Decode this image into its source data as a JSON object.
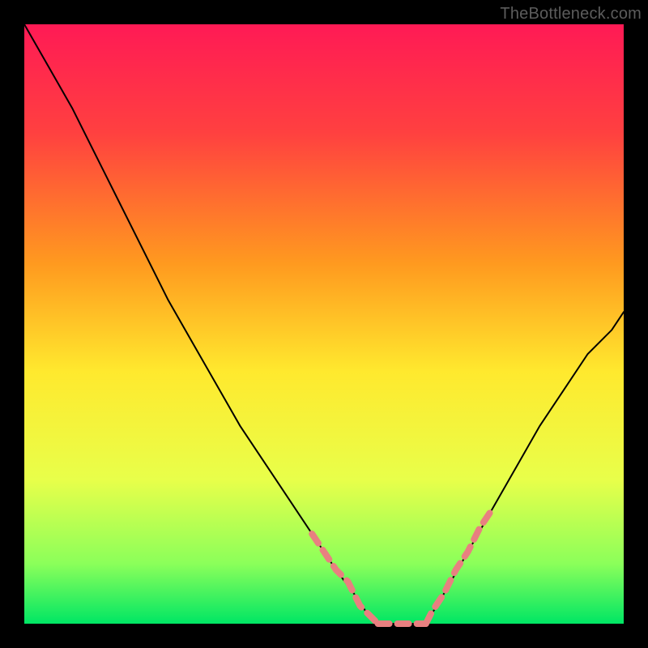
{
  "watermark": "TheBottleneck.com",
  "chart_data": {
    "type": "line",
    "title": "",
    "xlabel": "",
    "ylabel": "",
    "xlim": [
      0,
      100
    ],
    "ylim": [
      0,
      100
    ],
    "gradient": {
      "stops": [
        {
          "pct": 0,
          "color": "#ff1a55"
        },
        {
          "pct": 18,
          "color": "#ff4040"
        },
        {
          "pct": 40,
          "color": "#ff9a1f"
        },
        {
          "pct": 58,
          "color": "#ffe92e"
        },
        {
          "pct": 76,
          "color": "#e8ff4a"
        },
        {
          "pct": 90,
          "color": "#8bff5a"
        },
        {
          "pct": 100,
          "color": "#00e664"
        }
      ]
    },
    "series": [
      {
        "name": "left-curve",
        "stroke": "#000000",
        "width": 2,
        "x": [
          0,
          4,
          8,
          12,
          16,
          20,
          24,
          28,
          32,
          36,
          40,
          44,
          48,
          52,
          55,
          57,
          59
        ],
        "y": [
          100,
          93,
          86,
          78,
          70,
          62,
          54,
          47,
          40,
          33,
          27,
          21,
          15,
          9,
          5,
          2,
          0
        ]
      },
      {
        "name": "right-curve",
        "stroke": "#000000",
        "width": 2,
        "x": [
          67,
          70,
          74,
          78,
          82,
          86,
          90,
          94,
          98,
          100
        ],
        "y": [
          0,
          5,
          12,
          19,
          26,
          33,
          39,
          45,
          49,
          52
        ]
      },
      {
        "name": "plateau",
        "stroke": "#000000",
        "width": 2,
        "x": [
          59,
          61,
          63,
          65,
          67
        ],
        "y": [
          0,
          0,
          0,
          0,
          0
        ]
      }
    ],
    "dotted_segments": {
      "color": "#e88080",
      "width": 8,
      "segments": [
        {
          "name": "left-descent",
          "x": [
            48,
            50,
            52,
            54,
            55,
            56,
            57,
            58,
            59
          ],
          "y": [
            15,
            12,
            9,
            7,
            5,
            3,
            2,
            1,
            0
          ]
        },
        {
          "name": "bottom",
          "x": [
            59,
            60,
            61,
            62,
            63,
            64,
            65,
            66,
            67
          ],
          "y": [
            0,
            0,
            0,
            0,
            0,
            0,
            0,
            0,
            0
          ]
        },
        {
          "name": "right-ascent",
          "x": [
            67,
            68,
            70,
            72,
            74,
            76,
            78
          ],
          "y": [
            0,
            2,
            5,
            9,
            12,
            16,
            19
          ]
        }
      ]
    }
  }
}
